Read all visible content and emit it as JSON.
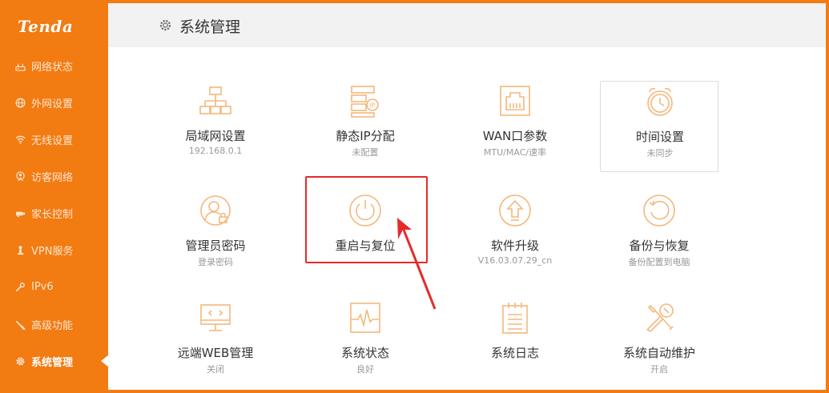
{
  "brand": {
    "logo": "Tenda"
  },
  "sidebar": {
    "items": [
      {
        "label": "网络状态",
        "icon": "network-status-icon"
      },
      {
        "label": "外网设置",
        "icon": "globe-icon"
      },
      {
        "label": "无线设置",
        "icon": "wifi-icon"
      },
      {
        "label": "访客网络",
        "icon": "guest-network-icon"
      },
      {
        "label": "家长控制",
        "icon": "parental-control-icon"
      },
      {
        "label": "VPN服务",
        "icon": "vpn-icon"
      },
      {
        "label": "IPv6",
        "icon": "wrench-icon"
      },
      {
        "label": "高级功能",
        "icon": "wrench-icon"
      },
      {
        "label": "系统管理",
        "icon": "gear-icon",
        "active": true
      }
    ]
  },
  "header": {
    "title": "系统管理",
    "icon": "gear-icon"
  },
  "tiles": [
    {
      "label": "局域网设置",
      "sub": "192.168.0.1",
      "icon": "lan-tree-icon"
    },
    {
      "label": "静态IP分配",
      "sub": "未配置",
      "icon": "static-ip-icon"
    },
    {
      "label": "WAN口参数",
      "sub": "MTU/MAC/速率",
      "icon": "wan-port-icon"
    },
    {
      "label": "时间设置",
      "sub": "未同步",
      "icon": "alarm-clock-icon"
    },
    {
      "label": "管理员密码",
      "sub": "登录密码",
      "icon": "admin-lock-icon"
    },
    {
      "label": "重启与复位",
      "sub": "",
      "icon": "power-icon"
    },
    {
      "label": "软件升级",
      "sub": "V16.03.07.29_cn",
      "icon": "upgrade-icon"
    },
    {
      "label": "备份与恢复",
      "sub": "备份配置到电脑",
      "icon": "restore-icon"
    },
    {
      "label": "远端WEB管理",
      "sub": "关闭",
      "icon": "remote-web-icon"
    },
    {
      "label": "系统状态",
      "sub": "良好",
      "icon": "system-status-icon"
    },
    {
      "label": "系统日志",
      "sub": "",
      "icon": "system-log-icon"
    },
    {
      "label": "系统自动维护",
      "sub": "开启",
      "icon": "tools-icon"
    }
  ],
  "colors": {
    "brand": "#f27b12",
    "icon": "#f5b77b",
    "annotation": "#e52a2a"
  }
}
